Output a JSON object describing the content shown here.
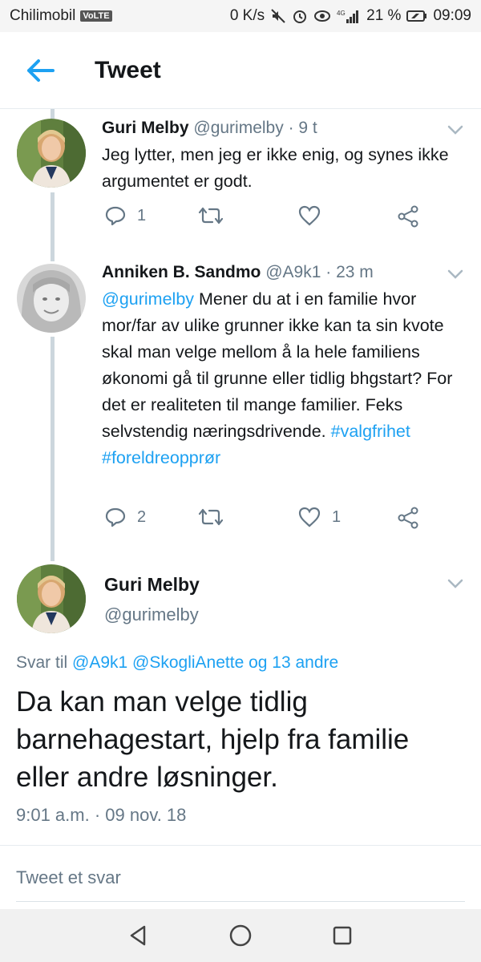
{
  "status_bar": {
    "carrier": "Chilimobil",
    "volte": "VoLTE",
    "speed": "0 K/s",
    "network": "4G",
    "battery": "21 %",
    "time": "09:09"
  },
  "header": {
    "title": "Tweet"
  },
  "tweets": [
    {
      "name": "Guri Melby",
      "handle": "@gurimelby",
      "sep": "·",
      "time": "9 t",
      "text": "Jeg lytter, men jeg er ikke enig, og synes ikke argumentet er godt.",
      "replies": "1",
      "retweets": "",
      "likes": ""
    },
    {
      "name": "Anniken B. Sandmo",
      "handle": "@A9k1",
      "sep": "·",
      "time": "23 m",
      "mention": "@gurimelby",
      "text": " Mener du at i en familie hvor mor/far av ulike grunner ikke kan ta sin kvote skal man velge mellom å la hele familiens økonomi gå til grunne eller tidlig bhgstart? For det er realiteten til mange familier. Feks selvstendig næringsdrivende. ",
      "hashtag1": "#valgfrihet",
      "hashtag2": "#foreldreopprør",
      "replies": "2",
      "retweets": "",
      "likes": "1"
    }
  ],
  "focused": {
    "name": "Guri Melby",
    "handle": "@gurimelby",
    "reply_prefix": "Svar til ",
    "reply_users": "@A9k1 @SkogliAnette og 13 andre",
    "text": "Da kan man velge tidlig barnehagestart, hjelp fra familie eller andre løsninger.",
    "timestamp": "9:01 a.m. · 09 nov. 18"
  },
  "reply_box": {
    "placeholder": "Tweet et svar"
  },
  "colors": {
    "accent": "#1da1f2",
    "muted": "#657786",
    "text": "#14171a",
    "divider": "#e6ecf0"
  },
  "icons": {
    "back": "arrow-left-icon",
    "caret": "chevron-down-icon",
    "reply": "reply-icon",
    "retweet": "retweet-icon",
    "like": "heart-icon",
    "share": "share-icon",
    "nav_back": "triangle-back-icon",
    "nav_home": "circle-home-icon",
    "nav_recents": "square-recents-icon"
  }
}
